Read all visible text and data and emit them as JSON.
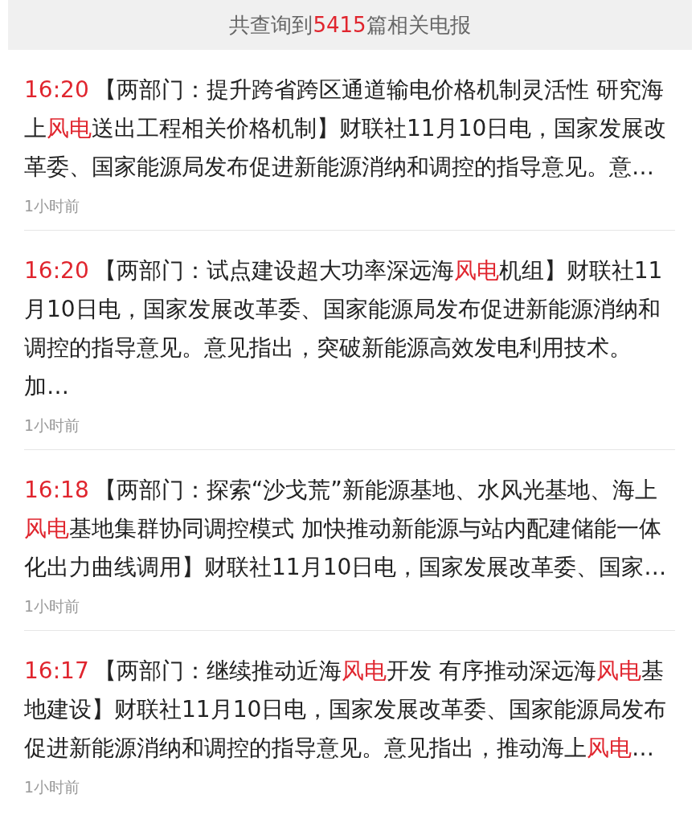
{
  "header": {
    "segments": [
      {
        "text": "共查询到",
        "highlight": false
      },
      {
        "text": "5415",
        "highlight": true
      },
      {
        "text": "篇相关电报",
        "highlight": false
      }
    ]
  },
  "items": [
    {
      "time": "16:20",
      "segments": [
        {
          "text": "【两部门：提升跨省跨区通道输电价格机制灵活性 研究海上",
          "highlight": false
        },
        {
          "text": "风电",
          "highlight": true
        },
        {
          "text": "送出工程相关价格机制】财联社11月10日电，国家发展改革委、国家能源局发布促进新能源消纳和调控的指导意见。意…",
          "highlight": false
        }
      ],
      "ago": "1小时前"
    },
    {
      "time": "16:20",
      "segments": [
        {
          "text": "【两部门：试点建设超大功率深远海",
          "highlight": false
        },
        {
          "text": "风电",
          "highlight": true
        },
        {
          "text": "机组】财联社11月10日电，国家发展改革委、国家能源局发布促进新能源消纳和调控的指导意见。意见指出，突破新能源高效发电利用技术。加…",
          "highlight": false
        }
      ],
      "ago": "1小时前"
    },
    {
      "time": "16:18",
      "segments": [
        {
          "text": "【两部门：探索“沙戈荒”新能源基地、水风光基地、海上",
          "highlight": false
        },
        {
          "text": "风电",
          "highlight": true
        },
        {
          "text": "基地集群协同调控模式 加快推动新能源与站内配建储能一体化出力曲线调用】财联社11月10日电，国家发展改革委、国家…",
          "highlight": false
        }
      ],
      "ago": "1小时前"
    },
    {
      "time": "16:17",
      "segments": [
        {
          "text": "【两部门：继续推动近海",
          "highlight": false
        },
        {
          "text": "风电",
          "highlight": true
        },
        {
          "text": "开发 有序推动深远海",
          "highlight": false
        },
        {
          "text": "风电",
          "highlight": true
        },
        {
          "text": "基地建设】财联社11月10日电，国家发展改革委、国家能源局发布促进新能源消纳和调控的指导意见。意见指出，推动海上",
          "highlight": false
        },
        {
          "text": "风电",
          "highlight": true
        },
        {
          "text": "…",
          "highlight": false
        }
      ],
      "ago": "1小时前"
    }
  ]
}
